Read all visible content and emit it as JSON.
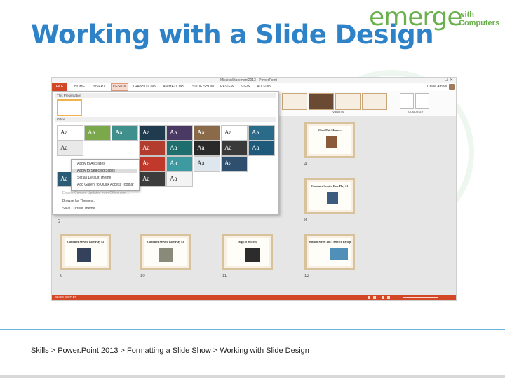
{
  "slide": {
    "title": "Working with a Slide Design",
    "logo_main": "emerge",
    "logo_with": "with",
    "logo_computers": "Computers",
    "footer": "Skills > Power.Point 2013 > Formatting a Slide Show > Working with Slide Design"
  },
  "colors": {
    "accent": "#d24726",
    "title": "#2e83c8",
    "logo": "#6ab04c"
  },
  "app": {
    "window_title": "MissionStatement2013 - PowerPoint",
    "user": "Chloe Amber",
    "menu": [
      "FILE",
      "HOME",
      "INSERT",
      "DESIGN",
      "TRANSITIONS",
      "ANIMATIONS",
      "SLIDE SHOW",
      "REVIEW",
      "VIEW",
      "ADD-INS"
    ],
    "ribbon": {
      "variants_label": "Variants",
      "customize_label": "Customize",
      "slide_size_label": "Slide Size",
      "format_bg_label": "Format Background"
    },
    "dropdown": {
      "this_presentation": "This Presentation",
      "office": "Office",
      "enable_updates": "Enable Content Updates from Office.com...",
      "browse": "Browse for Themes...",
      "save": "Save Current Theme..."
    },
    "context_menu": [
      "Apply to All Slides",
      "Apply to Selected Slides",
      "Set as Default Theme",
      "Add Gallery to Quick Access Toolbar"
    ],
    "slides": [
      {
        "num": "4",
        "title": "What This Means..."
      },
      {
        "num": "5",
        "title": ""
      },
      {
        "num": "8",
        "title": "Customer Service Role Play #1"
      },
      {
        "num": "9",
        "title": "Customer Service Role Play #2"
      },
      {
        "num": "10",
        "title": "Customer Service Role Play #3"
      },
      {
        "num": "11",
        "title": "Sign of Success"
      },
      {
        "num": "12",
        "title": "Mission Street Inn's Service Recognition Program - Part 1"
      }
    ],
    "status": "SLIDE 3 OF 17"
  }
}
